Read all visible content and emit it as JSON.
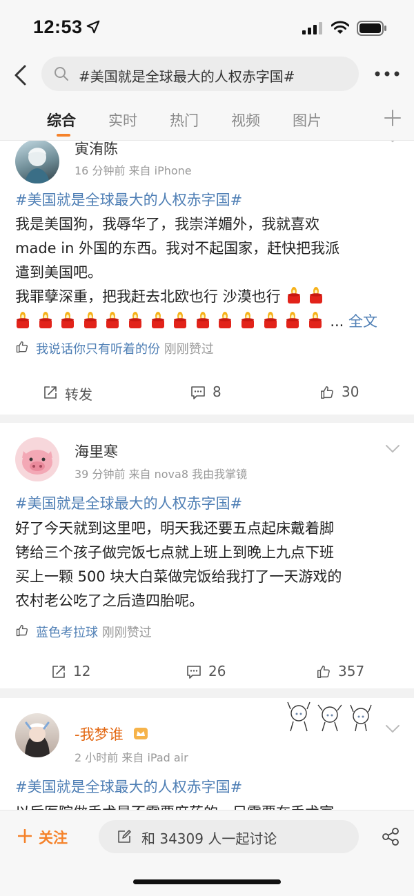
{
  "status_bar": {
    "time": "12:53"
  },
  "search": {
    "query": "#美国就是全球最大的人权赤字国#"
  },
  "tabs": [
    {
      "label": "综合",
      "active": true
    },
    {
      "label": "实时",
      "active": false
    },
    {
      "label": "热门",
      "active": false
    },
    {
      "label": "视频",
      "active": false
    },
    {
      "label": "图片",
      "active": false
    }
  ],
  "posts": [
    {
      "username": "寅洧陈",
      "meta": "16 分钟前  来自 iPhone",
      "hashtag": "#美国就是全球最大的人权赤字国#",
      "lines": [
        "我是美国狗，我辱华了，我崇洋媚外，我就喜欢",
        "made in 外国的东西。我对不起国家，赶快把我派",
        "遣到美国吧。",
        "我罪孽深重，把我赶去北欧也行 沙漠也行"
      ],
      "ellipsis": "...",
      "full_text_link": "全文",
      "liked_by": "我说话你只有听着的份",
      "liked_suffix": " 刚刚赞过",
      "reposts": "转发",
      "comments": "8",
      "likes": "30"
    },
    {
      "username": "海里寒",
      "meta": "39 分钟前  来自 nova8 我由我掌镜",
      "hashtag": "#美国就是全球最大的人权赤字国#",
      "lines": [
        "好了今天就到这里吧，明天我还要五点起床戴着脚",
        "铐给三个孩子做完饭七点就上班上到晚上九点下班",
        "买上一颗 500 块大白菜做完饭给我打了一天游戏的",
        "农村老公吃了之后造四胎呢。"
      ],
      "liked_by": "蓝色考拉球",
      "liked_suffix": " 刚刚赞过",
      "reposts": "12",
      "comments": "26",
      "likes": "357"
    },
    {
      "username": "-我梦谁",
      "meta": "2 小时前  来自 iPad air",
      "hashtag": "#美国就是全球最大的人权赤字国#",
      "partial_line": "以后医院做手术是不需要麻药的，只需要在手术室"
    }
  ],
  "bottom_bar": {
    "follow_label": "关注",
    "discuss_label": "和 34309 人一起讨论"
  },
  "colors": {
    "accent_orange": "#f5822a",
    "link_blue": "#4f7fb5",
    "candle_red": "#e2231a",
    "flame_yellow": "#f6b21b"
  },
  "icons": {
    "location": "location-arrow-icon",
    "candle": "candle-emoji-icon"
  }
}
